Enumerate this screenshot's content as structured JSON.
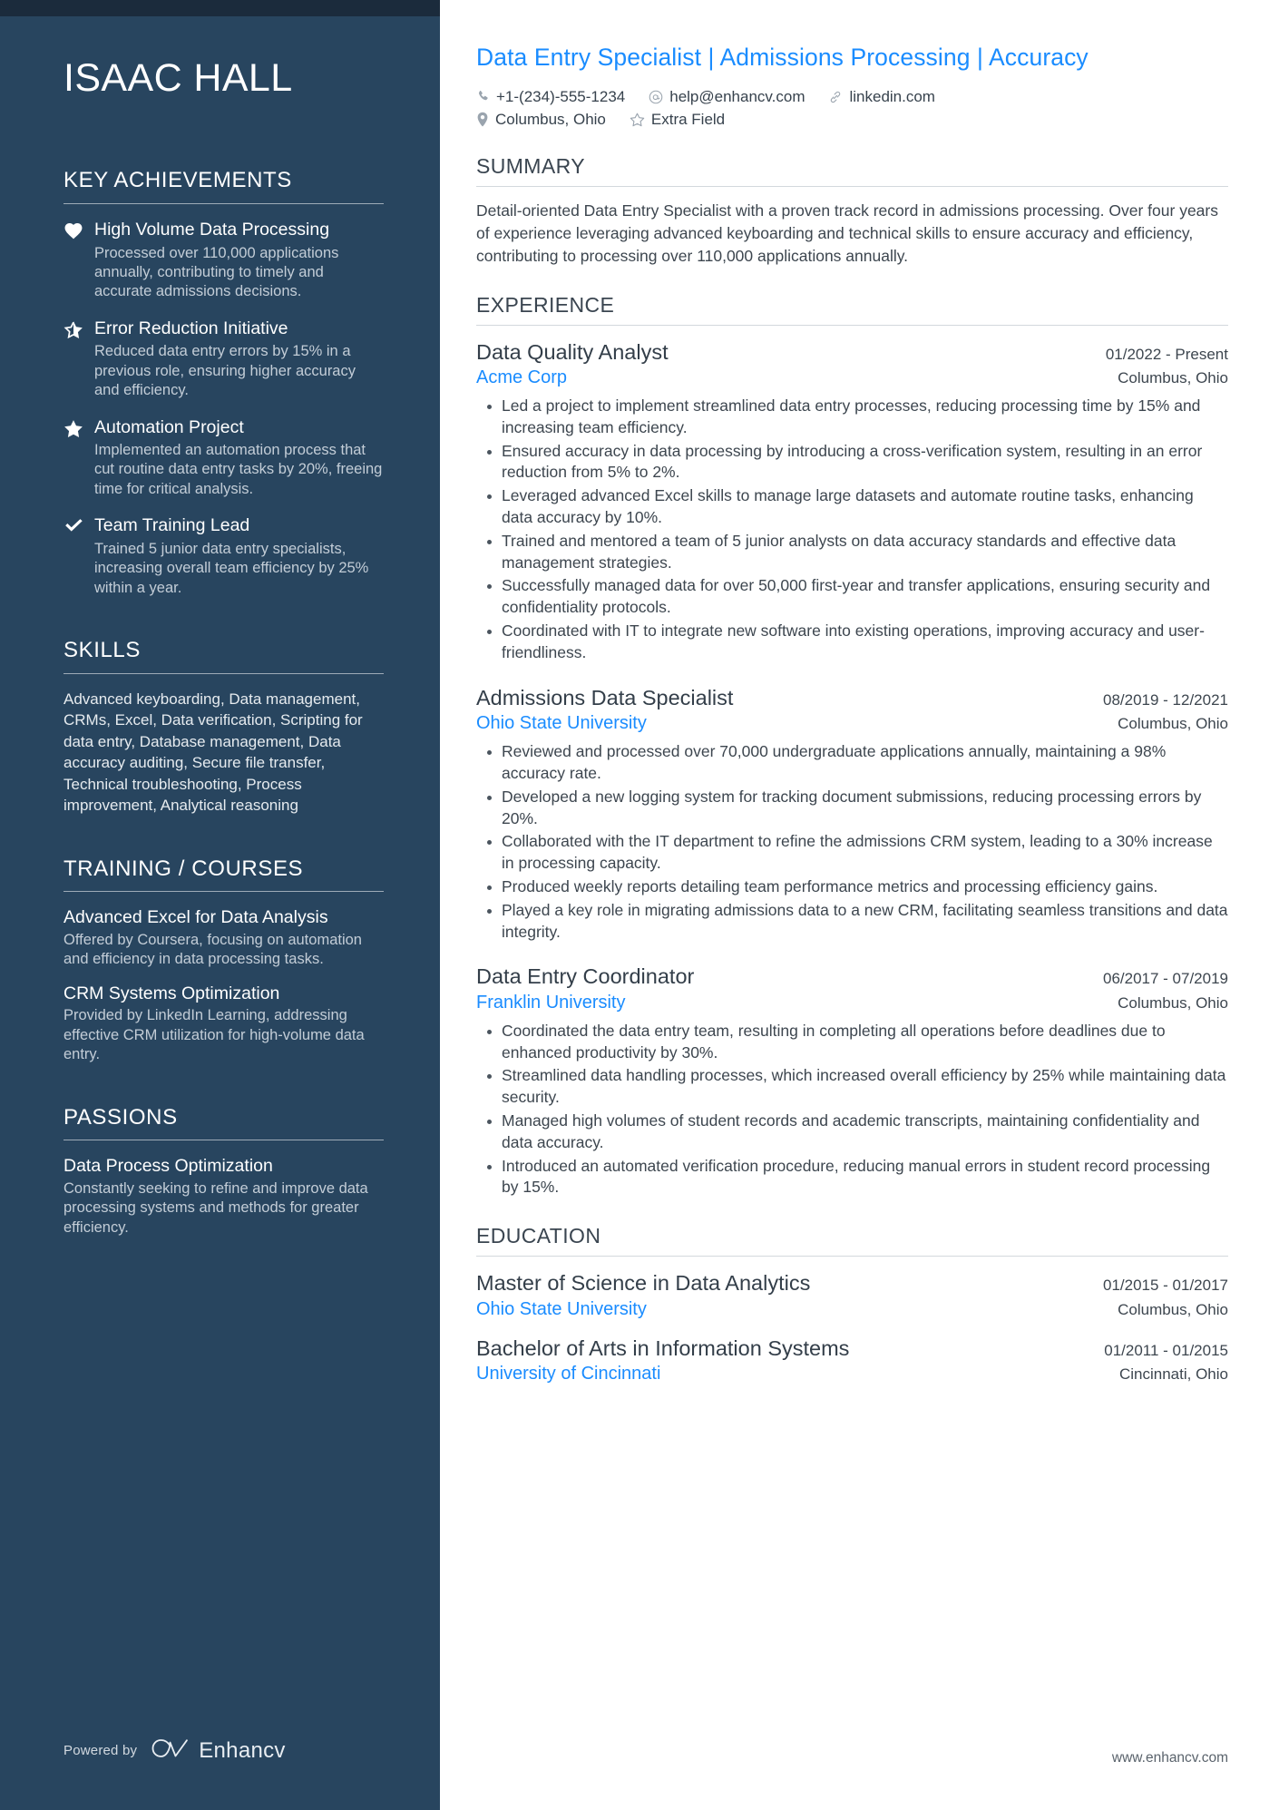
{
  "sidebar": {
    "name": "ISAAC HALL",
    "sections": {
      "achievements": {
        "heading": "KEY ACHIEVEMENTS",
        "items": [
          {
            "icon": "heart-icon",
            "title": "High Volume Data Processing",
            "desc": "Processed over 110,000 applications annually, contributing to timely and accurate admissions decisions."
          },
          {
            "icon": "half-star-icon",
            "title": "Error Reduction Initiative",
            "desc": "Reduced data entry errors by 15% in a previous role, ensuring higher accuracy and efficiency."
          },
          {
            "icon": "star-icon",
            "title": "Automation Project",
            "desc": "Implemented an automation process that cut routine data entry tasks by 20%, freeing time for critical analysis."
          },
          {
            "icon": "check-icon",
            "title": "Team Training Lead",
            "desc": "Trained 5 junior data entry specialists, increasing overall team efficiency by 25% within a year."
          }
        ]
      },
      "skills": {
        "heading": "SKILLS",
        "text": "Advanced keyboarding, Data management, CRMs, Excel, Data verification, Scripting for data entry, Database management, Data accuracy auditing, Secure file transfer, Technical troubleshooting, Process improvement, Analytical reasoning"
      },
      "training": {
        "heading": "TRAINING / COURSES",
        "items": [
          {
            "title": "Advanced Excel for Data Analysis",
            "desc": "Offered by Coursera, focusing on automation and efficiency in data processing tasks."
          },
          {
            "title": "CRM Systems Optimization",
            "desc": "Provided by LinkedIn Learning, addressing effective CRM utilization for high-volume data entry."
          }
        ]
      },
      "passions": {
        "heading": "PASSIONS",
        "items": [
          {
            "title": "Data Process Optimization",
            "desc": "Constantly seeking to refine and improve data processing systems and methods for greater efficiency."
          }
        ]
      }
    },
    "footer": {
      "powered_by": "Powered by",
      "brand": "Enhancv",
      "brand_icon": "enhancv-logo-icon"
    }
  },
  "main": {
    "headline": "Data Entry Specialist | Admissions Processing | Accuracy",
    "contact": {
      "row1": [
        {
          "icon": "phone-icon",
          "text": "+1-(234)-555-1234"
        },
        {
          "icon": "email-icon",
          "text": "help@enhancv.com"
        },
        {
          "icon": "link-icon",
          "text": "linkedin.com"
        }
      ],
      "row2": [
        {
          "icon": "location-pin-icon",
          "text": "Columbus, Ohio"
        },
        {
          "icon": "star-outline-icon",
          "text": "Extra Field"
        }
      ]
    },
    "summary": {
      "heading": "SUMMARY",
      "text": "Detail-oriented Data Entry Specialist with a proven track record in admissions processing. Over four years of experience leveraging advanced keyboarding and technical skills to ensure accuracy and efficiency, contributing to processing over 110,000 applications annually."
    },
    "experience": {
      "heading": "EXPERIENCE",
      "jobs": [
        {
          "title": "Data Quality Analyst",
          "date": "01/2022 - Present",
          "company": "Acme Corp",
          "location": "Columbus, Ohio",
          "bullets": [
            "Led a project to implement streamlined data entry processes, reducing processing time by 15% and increasing team efficiency.",
            "Ensured accuracy in data processing by introducing a cross-verification system, resulting in an error reduction from 5% to 2%.",
            "Leveraged advanced Excel skills to manage large datasets and automate routine tasks, enhancing data accuracy by 10%.",
            "Trained and mentored a team of 5 junior analysts on data accuracy standards and effective data management strategies.",
            "Successfully managed data for over 50,000 first-year and transfer applications, ensuring security and confidentiality protocols.",
            "Coordinated with IT to integrate new software into existing operations, improving accuracy and user-friendliness."
          ]
        },
        {
          "title": "Admissions Data Specialist",
          "date": "08/2019 - 12/2021",
          "company": "Ohio State University",
          "location": "Columbus, Ohio",
          "bullets": [
            "Reviewed and processed over 70,000 undergraduate applications annually, maintaining a 98% accuracy rate.",
            "Developed a new logging system for tracking document submissions, reducing processing errors by 20%.",
            "Collaborated with the IT department to refine the admissions CRM system, leading to a 30% increase in processing capacity.",
            "Produced weekly reports detailing team performance metrics and processing efficiency gains.",
            "Played a key role in migrating admissions data to a new CRM, facilitating seamless transitions and data integrity."
          ]
        },
        {
          "title": "Data Entry Coordinator",
          "date": "06/2017 - 07/2019",
          "company": "Franklin University",
          "location": "Columbus, Ohio",
          "bullets": [
            "Coordinated the data entry team, resulting in completing all operations before deadlines due to enhanced productivity by 30%.",
            "Streamlined data handling processes, which increased overall efficiency by 25% while maintaining data security.",
            "Managed high volumes of student records and academic transcripts, maintaining confidentiality and data accuracy.",
            "Introduced an automated verification procedure, reducing manual errors in student record processing by 15%."
          ]
        }
      ]
    },
    "education": {
      "heading": "EDUCATION",
      "entries": [
        {
          "degree": "Master of Science in Data Analytics",
          "date": "01/2015 - 01/2017",
          "school": "Ohio State University",
          "location": "Columbus, Ohio"
        },
        {
          "degree": "Bachelor of Arts in Information Systems",
          "date": "01/2011 - 01/2015",
          "school": "University of Cincinnati",
          "location": "Cincinnati, Ohio"
        }
      ]
    },
    "footer_url": "www.enhancv.com"
  },
  "colors": {
    "sidebar_bg": "#28455f",
    "sidebar_topbar": "#1b2b3c",
    "accent_link": "#1a8cff",
    "body_text": "#3d464f"
  }
}
